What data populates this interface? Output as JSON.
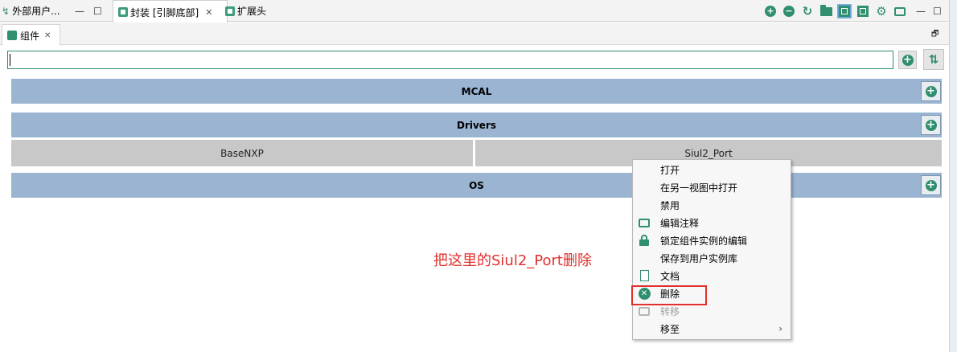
{
  "top_tabs": [
    {
      "label": "外部用户..."
    },
    {
      "label": "封装 [引脚底部]"
    },
    {
      "label": "扩展头"
    }
  ],
  "top_controls": {
    "minimize": "—",
    "maximize": "☐",
    "close": "✕"
  },
  "toolbar_icons": [
    "zoom-in-icon",
    "zoom-out-icon",
    "refresh-icon",
    "folder-icon",
    "chip-view-icon",
    "chip-outline-icon",
    "settings-chip-icon",
    "comment-icon"
  ],
  "components_panel": {
    "tab_label": "组件",
    "close": "✕",
    "restore": "🗗"
  },
  "search": {
    "value": "",
    "placeholder": ""
  },
  "categories": [
    {
      "label": "MCAL",
      "add": "+"
    },
    {
      "label": "Drivers",
      "add": "+"
    },
    {
      "label": "OS",
      "add": "+"
    }
  ],
  "drivers_items": [
    {
      "label": "BaseNXP"
    },
    {
      "label": "Siul2_Port"
    }
  ],
  "annotation": "把这里的Siul2_Port删除",
  "context_menu": [
    {
      "label": "打开",
      "icon": "",
      "disabled": false
    },
    {
      "label": "在另一视图中打开",
      "icon": "",
      "disabled": false
    },
    {
      "label": "禁用",
      "icon": "",
      "disabled": false
    },
    {
      "label": "编辑注释",
      "icon": "comment-icon",
      "disabled": false
    },
    {
      "label": "锁定组件实例的编辑",
      "icon": "lock-icon",
      "disabled": false
    },
    {
      "label": "保存到用户实例库",
      "icon": "",
      "disabled": false
    },
    {
      "label": "文档",
      "icon": "document-icon",
      "disabled": false
    },
    {
      "label": "删除",
      "icon": "delete-icon",
      "disabled": false
    },
    {
      "label": "转移",
      "icon": "move-icon",
      "disabled": true
    },
    {
      "label": "移至",
      "icon": "",
      "disabled": false,
      "submenu": "›"
    }
  ],
  "colors": {
    "accent": "#2f8f6e",
    "category_bar": "#9bb4d2",
    "item_bg": "#c8c8c8",
    "annotation": "#e0312c"
  }
}
